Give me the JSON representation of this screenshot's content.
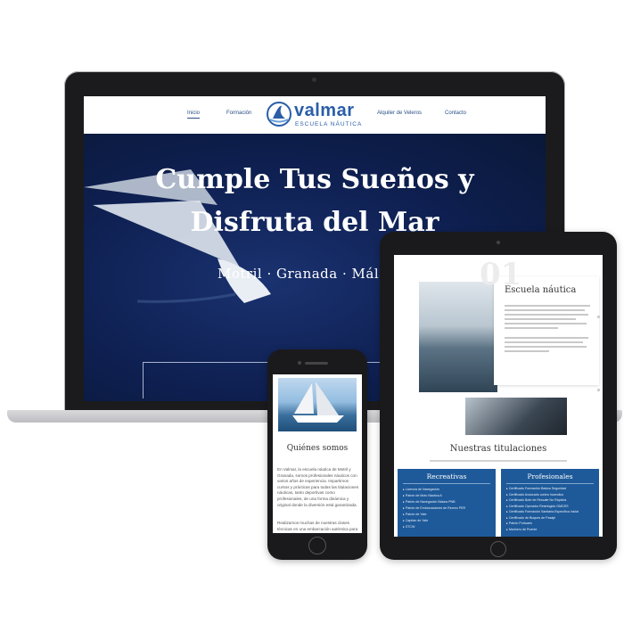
{
  "laptop": {
    "nav": {
      "items": [
        "Inicio",
        "Formación",
        "Alquiler de Veleros",
        "Contacto"
      ],
      "active": "Inicio"
    },
    "logo": {
      "name": "valmar",
      "subtitle": "ESCUELA NÁUTICA"
    },
    "hero": {
      "title_line1": "Cumple Tus Sueños y",
      "title_line2": "Disfruta del Mar",
      "locations": "Motril · Granada · Málaga"
    }
  },
  "tablet": {
    "number": "01",
    "heading": "Escuela náutica",
    "section_title": "Nuestras titulaciones",
    "col1": {
      "title": "Recreativas",
      "items": [
        "Licencia de Navegación",
        "Patrón de Moto Náutica A",
        "Patrón de Navegación Básica PNB",
        "Patrón de Embarcaciones de Recreo PER",
        "Patrón de Yate",
        "Capitán de Yate",
        "STCW"
      ]
    },
    "col2": {
      "title": "Profesionales",
      "items": [
        "Certificado Formación Básica Seguridad",
        "Certificado Avanzado contra Incendios",
        "Certificado Bote de Rescate No Rápidos",
        "Certificado Operador Restringido GMDSS",
        "Certificado Formación Sanitaria Específica Inicial",
        "Certificado de Buques de Pasaje",
        "Patrón Portuario",
        "Marinero de Puente"
      ]
    }
  },
  "phone": {
    "heading": "Quiénes somos",
    "para1": "En Valmar, la escuela náutica de Motril y Granada, somos profesionales náuticos con varios años de experiencia. Impartimos cursos y prácticas para todas las titulaciones náuticas, tanto deportivas como profesionales, de una forma dinámica y original donde la diversión está garantizada.",
    "para2": "Realizamos muchas de nuestras clases técnicas en una embarcación auténtica para que puedas ver"
  }
}
